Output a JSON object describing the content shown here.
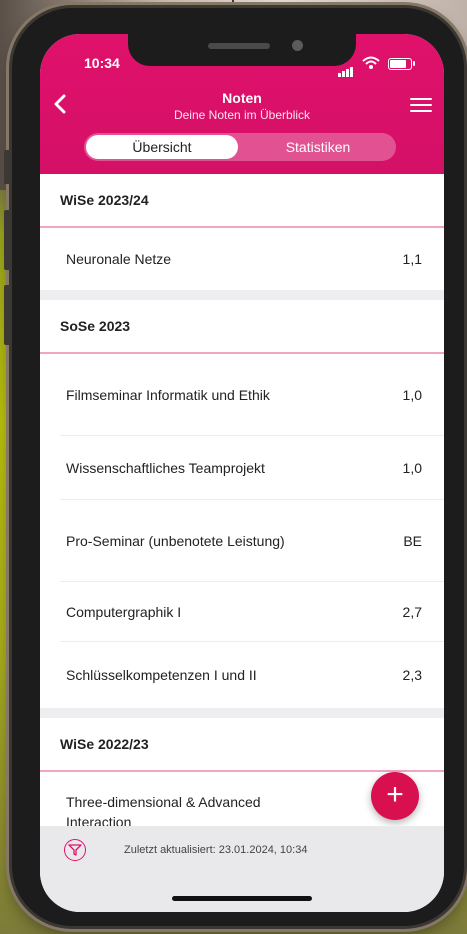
{
  "status_bar": {
    "time": "10:34"
  },
  "header": {
    "title": "Noten",
    "subtitle": "Deine Noten im Überblick",
    "tabs": [
      {
        "label": "Übersicht",
        "active": true
      },
      {
        "label": "Statistiken",
        "active": false
      }
    ]
  },
  "sections": [
    {
      "title": "WiSe 2023/24",
      "courses": [
        {
          "name": "Neuronale Netze",
          "grade": "1,1"
        }
      ]
    },
    {
      "title": "SoSe 2023",
      "courses": [
        {
          "name": "Filmseminar Informatik und Ethik",
          "grade": "1,0"
        },
        {
          "name": "Wissenschaftliches Teamprojekt",
          "grade": "1,0"
        },
        {
          "name": "Pro-Seminar (unbenotete Leistung)",
          "grade": "BE"
        },
        {
          "name": "Computergraphik I",
          "grade": "2,7"
        },
        {
          "name": "Schlüsselkompetenzen I und II",
          "grade": "2,3"
        }
      ]
    },
    {
      "title": "WiSe 2022/23",
      "courses": [
        {
          "name": "Three-dimensional & Advanced Interaction",
          "grade": ""
        }
      ]
    }
  ],
  "fab": {
    "label": "+"
  },
  "footer": {
    "last_updated": "Zuletzt aktualisiert: 23.01.2024, 10:34"
  },
  "colors": {
    "accent": "#e0116b",
    "fab": "#d8104f",
    "divider": "#f2a5c2"
  },
  "icons": {
    "back": "chevron-left-icon",
    "menu": "hamburger-menu-icon",
    "filter": "filter-icon"
  }
}
